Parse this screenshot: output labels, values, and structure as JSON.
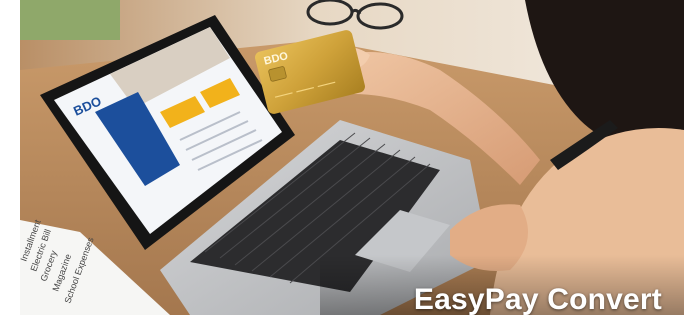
{
  "banner": {
    "title": "EasyPay Convert"
  },
  "card": {
    "logo_text": "BDO"
  },
  "screen": {
    "logo_text": "BDO"
  },
  "paper": {
    "lines": [
      "Installment",
      "Electric Bill",
      "Grocery",
      "Magazine",
      "School Expenses"
    ]
  },
  "colors": {
    "bdo_blue": "#1c4f9c",
    "bdo_gold": "#f2b21b",
    "card_gold": "#d9ad3f",
    "title_text": "#ffffff"
  }
}
